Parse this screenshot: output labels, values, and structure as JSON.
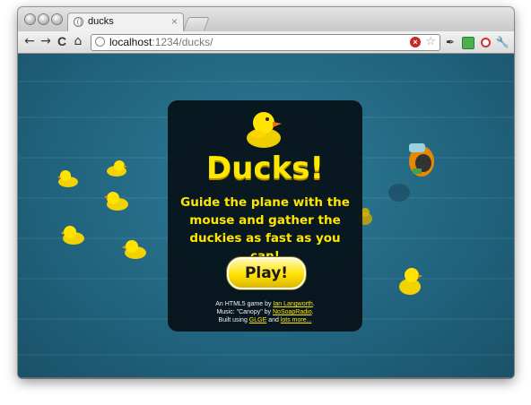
{
  "browser": {
    "tab": {
      "title": "ducks",
      "close": "×",
      "favicon": "globe-icon"
    },
    "nav": {
      "back": "←",
      "forward": "→",
      "reload": "C",
      "home": "⌂"
    },
    "address": {
      "host": "localhost",
      "path": ":1234/ducks/",
      "icon": "globe-icon"
    },
    "omnibox_icons": {
      "stop": "×",
      "star": "☆"
    },
    "extensions": [
      "pin-icon",
      "extension-green-icon",
      "extension-red-icon",
      "wrench-icon"
    ]
  },
  "game": {
    "title": "Ducks!",
    "subtitle": "Guide the plane with the mouse and gather the duckies as fast as you can!",
    "play_label": "Play!",
    "credits": {
      "line1_prefix": "An HTML5 game by ",
      "author": "Ian Langworth",
      "line1_suffix": ".",
      "line2_prefix": "Music: \"Canopy\" by ",
      "music_author": "NoSoapRadio",
      "line2_suffix": ".",
      "line3_prefix": "Built using ",
      "engine": "GLGE",
      "line3_mid": " and ",
      "more": "lots more..."
    }
  },
  "colors": {
    "water": "#226580",
    "accent": "#ffe600",
    "panel": "#050e14"
  }
}
